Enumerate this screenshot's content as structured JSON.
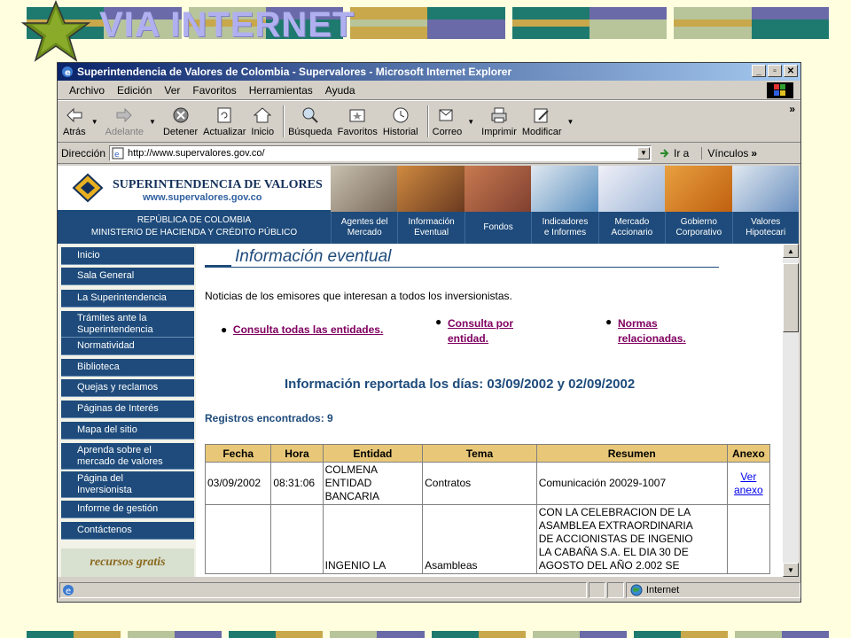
{
  "slide": {
    "title": "VIA INTERNET",
    "colors": {
      "teal": "#1E7A6E",
      "olive": "#C8A84B",
      "sage": "#B8C49A",
      "slate": "#6A6AA8",
      "background": "#FFFFE0"
    }
  },
  "browser": {
    "window_title": "Superintendencia de Valores de Colombia - Supervalores - Microsoft Internet Explorer",
    "menu": [
      "Archivo",
      "Edición",
      "Ver",
      "Favoritos",
      "Herramientas",
      "Ayuda"
    ],
    "toolbar": {
      "back": "Atrás",
      "forward": "Adelante",
      "stop": "Detener",
      "refresh": "Actualizar",
      "home": "Inicio",
      "search": "Búsqueda",
      "favorites": "Favoritos",
      "history": "Historial",
      "mail": "Correo",
      "print": "Imprimir",
      "edit": "Modificar"
    },
    "address_label": "Dirección",
    "address_value": "http://www.supervalores.gov.co/",
    "go_label": "Ir a",
    "links_label": "Vínculos",
    "status_zone": "Internet"
  },
  "site": {
    "name": "SUPERINTENDENCIA DE VALORES",
    "url": "www.supervalores.gov.co",
    "republic": "REPÚBLICA DE COLOMBIA",
    "ministry": "MINISTERIO DE HACIENDA Y CRÉDITO PÚBLICO",
    "nav": [
      {
        "line1": "Agentes del",
        "line2": "Mercado"
      },
      {
        "line1": "Información",
        "line2": "Eventual"
      },
      {
        "line1": "Fondos",
        "line2": ""
      },
      {
        "line1": "Indicadores",
        "line2": "e Informes"
      },
      {
        "line1": "Mercado",
        "line2": "Accionario"
      },
      {
        "line1": "Gobierno",
        "line2": "Corporativo"
      },
      {
        "line1": "Valores",
        "line2": "Hipotecari"
      }
    ],
    "sidebar": [
      {
        "l1": "Inicio",
        "l2": ""
      },
      {
        "l1": "Sala General",
        "l2": ""
      },
      {
        "l1": "La Superintendencia",
        "l2": ""
      },
      {
        "l1": "Trámites ante la",
        "l2": "Superintendencia"
      },
      {
        "l1": "Normatividad",
        "l2": ""
      },
      {
        "l1": "Biblioteca",
        "l2": ""
      },
      {
        "l1": "Quejas y reclamos",
        "l2": ""
      },
      {
        "l1": "Páginas de Interés",
        "l2": ""
      },
      {
        "l1": "Mapa del sitio",
        "l2": ""
      },
      {
        "l1": "Aprenda sobre el",
        "l2": "mercado de valores"
      },
      {
        "l1": "Página del",
        "l2": "Inversionista"
      },
      {
        "l1": "Informe de gestión",
        "l2": ""
      },
      {
        "l1": "Contáctenos",
        "l2": ""
      }
    ],
    "recursos": "recursos gratis"
  },
  "content": {
    "section_title": "Información eventual",
    "intro": "Noticias de los emisores que interesan a todos los inversionistas.",
    "link_all": "Consulta todas las entidades.",
    "link_entity_1": "Consulta por",
    "link_entity_2": "entidad.",
    "link_norms_1": "Normas",
    "link_norms_2": "relacionadas.",
    "report_title": "Información reportada los días: 03/09/2002 y 02/09/2002",
    "records": "Registros encontrados: 9",
    "table": {
      "headers": [
        "Fecha",
        "Hora",
        "Entidad",
        "Tema",
        "Resumen",
        "Anexo"
      ],
      "rows": [
        {
          "fecha": "03/09/2002",
          "hora": "08:31:06",
          "entidad": [
            "COLMENA",
            "ENTIDAD",
            "BANCARIA"
          ],
          "tema": "Contratos",
          "resumen": [
            "Comunicación 20029-1007"
          ],
          "anexo_1": "Ver",
          "anexo_2": "anexo"
        },
        {
          "fecha": "",
          "hora": "",
          "entidad": [
            "INGENIO LA"
          ],
          "tema": "Asambleas",
          "resumen": [
            "CON LA CELEBRACION DE LA",
            "ASAMBLEA EXTRAORDINARIA",
            "DE ACCIONISTAS DE INGENIO",
            "LA CABAÑA S.A. EL DIA 30 DE",
            "AGOSTO DEL AÑO 2.002 SE"
          ],
          "anexo_1": "",
          "anexo_2": ""
        }
      ]
    }
  }
}
